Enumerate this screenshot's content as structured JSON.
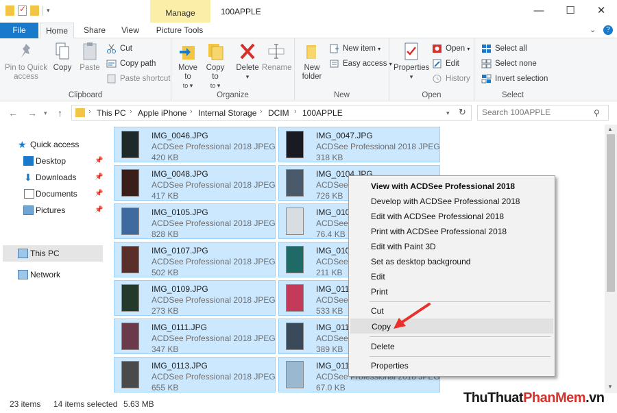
{
  "titlebar": {
    "context_tab": "Manage",
    "title": "100APPLE",
    "controls": [
      "—",
      "☐",
      "✕"
    ]
  },
  "tabs": {
    "file": "File",
    "home": "Home",
    "share": "Share",
    "view": "View",
    "picture_tools": "Picture Tools"
  },
  "ribbon": {
    "clipboard": {
      "label": "Clipboard",
      "pin": "Pin to Quick access",
      "copy": "Copy",
      "paste": "Paste",
      "cut": "Cut",
      "copy_path": "Copy path",
      "paste_shortcut": "Paste shortcut"
    },
    "organize": {
      "label": "Organize",
      "move_to": "Move to",
      "copy_to": "Copy to",
      "delete": "Delete",
      "rename": "Rename"
    },
    "new": {
      "label": "New",
      "new_folder": "New folder",
      "new_item": "New item",
      "easy_access": "Easy access"
    },
    "open": {
      "label": "Open",
      "properties": "Properties",
      "open": "Open",
      "edit": "Edit",
      "history": "History"
    },
    "select": {
      "label": "Select",
      "select_all": "Select all",
      "select_none": "Select none",
      "invert_selection": "Invert selection"
    }
  },
  "address": {
    "crumbs": [
      "This PC",
      "Apple iPhone",
      "Internal Storage",
      "DCIM",
      "100APPLE"
    ],
    "search_placeholder": "Search 100APPLE"
  },
  "navpane": {
    "quick_access": "Quick access",
    "desktop": "Desktop",
    "downloads": "Downloads",
    "documents": "Documents",
    "pictures": "Pictures",
    "this_pc": "This PC",
    "network": "Network"
  },
  "files": [
    {
      "name": "IMG_0046.JPG",
      "type": "ACDSee Professional 2018 JPEG I...",
      "size": "420 KB",
      "color": "#1e2a2a"
    },
    {
      "name": "IMG_0047.JPG",
      "type": "ACDSee Professional 2018 JPEG I...",
      "size": "318 KB",
      "color": "#1a1a22"
    },
    {
      "name": "IMG_0048.JPG",
      "type": "ACDSee Professional 2018 JPEG I...",
      "size": "417 KB",
      "color": "#3a1e1a"
    },
    {
      "name": "IMG_0104.JPG",
      "type": "ACDSee Professional 2018 JPEG I...",
      "size": "726 KB",
      "color": "#4a5a6a"
    },
    {
      "name": "IMG_0105.JPG",
      "type": "ACDSee Professional 2018 JPEG I...",
      "size": "828 KB",
      "color": "#3f6aa0"
    },
    {
      "name": "IMG_0106.JPG",
      "type": "ACDSee Professional 2018 JPEG I...",
      "size": "76.4 KB",
      "color": "#d8dde2"
    },
    {
      "name": "IMG_0107.JPG",
      "type": "ACDSee Professional 2018 JPEG I...",
      "size": "502 KB",
      "color": "#5a2f2a"
    },
    {
      "name": "IMG_0108.JPG",
      "type": "ACDSee Professional 2018 JPEG I...",
      "size": "211 KB",
      "color": "#1f6a66"
    },
    {
      "name": "IMG_0109.JPG",
      "type": "ACDSee Professional 2018 JPEG I...",
      "size": "273 KB",
      "color": "#233a2a"
    },
    {
      "name": "IMG_0110.JPG",
      "type": "ACDSee Professional 2018 JPEG I...",
      "size": "533 KB",
      "color": "#c43a5a"
    },
    {
      "name": "IMG_0111.JPG",
      "type": "ACDSee Professional 2018 JPEG I...",
      "size": "347 KB",
      "color": "#6a3a4a"
    },
    {
      "name": "IMG_0112.JPG",
      "type": "ACDSee Professional 2018 JPEG I...",
      "size": "389 KB",
      "color": "#3a4a5a"
    },
    {
      "name": "IMG_0113.JPG",
      "type": "ACDSee Professional 2018 JPEG I...",
      "size": "655 KB",
      "color": "#4a4a4a"
    },
    {
      "name": "IMG_0114.JPG",
      "type": "ACDSee Professional 2018 JPEG I...",
      "size": "67.0 KB",
      "color": "#9ab8d0"
    }
  ],
  "context_menu": {
    "view": "View with ACDSee Professional 2018",
    "develop": "Develop with ACDSee Professional 2018",
    "edit_acdsee": "Edit with ACDSee Professional 2018",
    "print_acdsee": "Print with ACDSee Professional 2018",
    "paint3d": "Edit with Paint 3D",
    "desktop_bg": "Set as desktop background",
    "edit": "Edit",
    "print": "Print",
    "cut": "Cut",
    "copy": "Copy",
    "delete": "Delete",
    "properties": "Properties"
  },
  "status": {
    "count": "23 items",
    "selected": "14 items selected",
    "size": "5.63 MB"
  },
  "watermark": {
    "part1": "ThuThuat",
    "part2": "PhanMem",
    "part3": ".vn",
    "colors": [
      "#1a1a1a",
      "#d6322c",
      "#1a1a1a"
    ]
  },
  "colors": {
    "accent": "#1979ca",
    "selection": "#cce8ff",
    "manage_tab": "#fbeea8"
  }
}
